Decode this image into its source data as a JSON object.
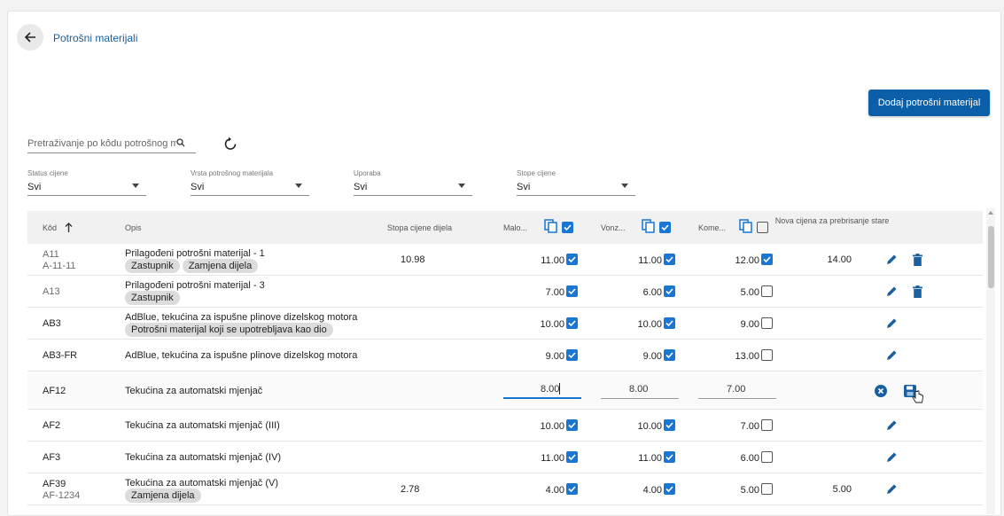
{
  "header": {
    "title": "Potrošni materijali",
    "back_icon": "arrow-left-icon"
  },
  "actions": {
    "add_label": "Dodaj potrošni materijal"
  },
  "search": {
    "placeholder": "Pretraživanje po kôdu potrošnog materijal..."
  },
  "filters": [
    {
      "label": "Status cijene",
      "value": "Svi"
    },
    {
      "label": "Vrsta potrošnog materijala",
      "value": "Svi"
    },
    {
      "label": "Uporaba",
      "value": "Svi"
    },
    {
      "label": "Stope cijene",
      "value": "Svi"
    }
  ],
  "columns": {
    "code": "Kôd",
    "desc": "Opis",
    "rate": "Stopa cijene dijela",
    "retail": "Malo...",
    "wholesale": "Vonz...",
    "commercial": "Kome...",
    "newprice": "Nova cijena za prebrisanje stare"
  },
  "header_checks": {
    "retail": true,
    "wholesale": true,
    "commercial": false
  },
  "rows": [
    {
      "code": "A11",
      "code2": "A-11-11",
      "grey": true,
      "desc": "Prilagođeni potrošni materijal - 1",
      "chips": [
        "Zastupnik",
        "Zamjena dijela"
      ],
      "rate": "10.98",
      "retail": "11.00",
      "r_on": true,
      "wholesale": "11.00",
      "w_on": true,
      "commercial": "12.00",
      "c_on": true,
      "newprice": "14.00",
      "delete": true
    },
    {
      "code": "A13",
      "code2": "",
      "grey": true,
      "desc": "Prilagođeni potrošni materijal - 3",
      "chips": [
        "Zastupnik"
      ],
      "rate": "",
      "retail": "7.00",
      "r_on": true,
      "wholesale": "6.00",
      "w_on": true,
      "commercial": "5.00",
      "c_on": false,
      "newprice": "",
      "delete": true
    },
    {
      "code": "AB3",
      "code2": "",
      "grey": false,
      "desc": "AdBlue, tekućina za ispušne plinove dizelskog motora",
      "chips": [
        "Potrošni materijal koji se upotrebljava kao dio"
      ],
      "rate": "",
      "retail": "10.00",
      "r_on": true,
      "wholesale": "10.00",
      "w_on": true,
      "commercial": "9.00",
      "c_on": false,
      "newprice": "",
      "delete": false
    },
    {
      "code": "AB3-FR",
      "code2": "",
      "grey": false,
      "desc": "AdBlue, tekućina za ispušne plinove dizelskog motora",
      "chips": [],
      "rate": "",
      "retail": "9.00",
      "r_on": true,
      "wholesale": "9.00",
      "w_on": true,
      "commercial": "13.00",
      "c_on": false,
      "newprice": "",
      "delete": false
    },
    {
      "code": "AF12",
      "code2": "",
      "grey": false,
      "desc": "Tekućina za automatski mjenjač",
      "chips": [],
      "rate": "",
      "retail": "8.00",
      "wholesale": "8.00",
      "commercial": "7.00",
      "newprice": "",
      "editing": true
    },
    {
      "code": "AF2",
      "code2": "",
      "grey": false,
      "desc": "Tekućina za automatski mjenjač (III)",
      "chips": [],
      "rate": "",
      "retail": "10.00",
      "r_on": true,
      "wholesale": "10.00",
      "w_on": true,
      "commercial": "7.00",
      "c_on": false,
      "newprice": "",
      "delete": false
    },
    {
      "code": "AF3",
      "code2": "",
      "grey": false,
      "desc": "Tekućina za automatski mjenjač (IV)",
      "chips": [],
      "rate": "",
      "retail": "11.00",
      "r_on": true,
      "wholesale": "11.00",
      "w_on": true,
      "commercial": "6.00",
      "c_on": false,
      "newprice": "",
      "delete": false
    },
    {
      "code": "AF39",
      "code2": "AF-1234",
      "grey": false,
      "desc": "Tekućina za automatski mjenjač (V)",
      "chips": [
        "Zamjena dijela"
      ],
      "rate": "2.78",
      "retail": "4.00",
      "r_on": true,
      "wholesale": "4.00",
      "w_on": true,
      "commercial": "5.00",
      "c_on": false,
      "newprice": "5.00",
      "delete": false
    }
  ],
  "colors": {
    "accent": "#1976d2",
    "button": "#0b5fa8",
    "link": "#1a5fa0"
  }
}
